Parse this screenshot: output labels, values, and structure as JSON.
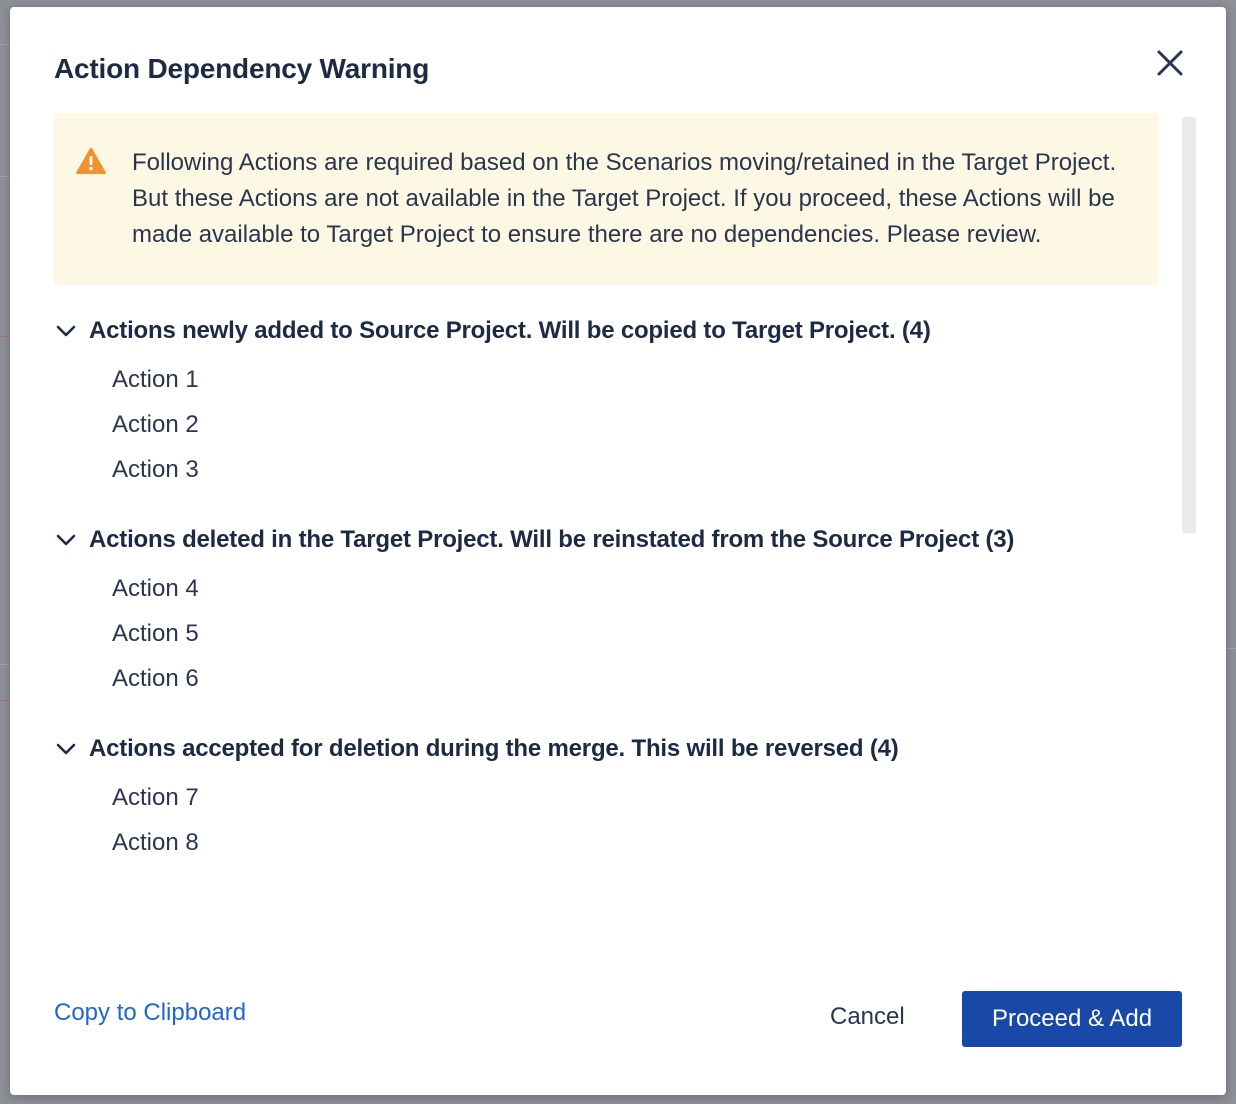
{
  "dialog": {
    "title": "Action Dependency Warning",
    "close_icon": "close-icon"
  },
  "warning": {
    "icon": "warning-triangle-icon",
    "icon_color": "#f0922f",
    "background_color": "#fdf8e4",
    "text": "Following Actions are required based on the Scenarios moving/retained in the Target Project. But these Actions are not available in the Target Project. If you proceed, these Actions will be made available to Target Project to ensure there are no dependencies. Please review."
  },
  "sections": [
    {
      "title": "Actions newly added to Source Project. Will be copied to Target Project. (4)",
      "expanded": true,
      "items": [
        "Action 1",
        "Action 2",
        "Action 3"
      ]
    },
    {
      "title": "Actions deleted in the Target Project. Will be reinstated from the Source Project (3)",
      "expanded": true,
      "items": [
        "Action 4",
        "Action 5",
        "Action 6"
      ]
    },
    {
      "title": "Actions accepted for deletion during the merge. This will be reversed (4)",
      "expanded": true,
      "items": [
        "Action 7",
        "Action 8"
      ]
    }
  ],
  "footer": {
    "copy_label": "Copy to Clipboard",
    "cancel_label": "Cancel",
    "proceed_label": "Proceed &  Add"
  },
  "colors": {
    "primary": "#1848a8",
    "link": "#1f66d1",
    "heading": "#1c2a44",
    "overlay": "#8e9097"
  }
}
